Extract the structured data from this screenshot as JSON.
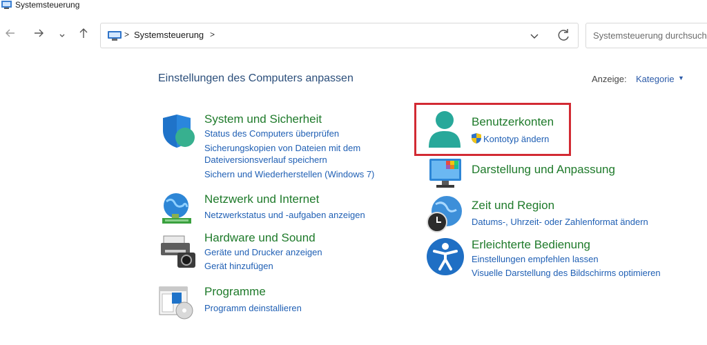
{
  "window": {
    "title": "Systemsteuerung"
  },
  "nav": {
    "back": "back-arrow-icon",
    "forward": "forward-arrow-icon",
    "recent": "chevron-down-icon",
    "up": "up-arrow-icon"
  },
  "address": {
    "crumb": "Systemsteuerung",
    "separator": ">"
  },
  "search": {
    "placeholder": "Systemsteuerung durchsuche"
  },
  "main": {
    "title": "Einstellungen des Computers anpassen",
    "view_label": "Anzeige:",
    "view_value": "Kategorie"
  },
  "categories": [
    {
      "title": "System und Sicherheit",
      "icon": "shield-icon",
      "links": [
        "Status des Computers überprüfen",
        "Sicherungskopien von Dateien mit dem",
        "Dateiversionsverlauf speichern",
        "Sichern und Wiederherstellen (Windows 7)"
      ]
    },
    {
      "title": "Netzwerk und Internet",
      "icon": "network-icon",
      "links": [
        "Netzwerkstatus und -aufgaben anzeigen"
      ]
    },
    {
      "title": "Hardware und Sound",
      "icon": "printer-icon",
      "links": [
        "Geräte und Drucker anzeigen",
        "Gerät hinzufügen"
      ]
    },
    {
      "title": "Programme",
      "icon": "programs-icon",
      "links": [
        "Programm deinstallieren"
      ]
    },
    {
      "title": "Benutzerkonten",
      "icon": "user-icon",
      "links": [
        "Kontotyp ändern"
      ]
    },
    {
      "title": "Darstellung und Anpassung",
      "icon": "monitor-icon",
      "links": []
    },
    {
      "title": "Zeit und Region",
      "icon": "globe-clock-icon",
      "links": [
        "Datums-, Uhrzeit- oder Zahlenformat ändern"
      ]
    },
    {
      "title": "Erleichterte Bedienung",
      "icon": "accessibility-icon",
      "links": [
        "Einstellungen empfehlen lassen",
        "Visuelle Darstellung des Bildschirms optimieren"
      ]
    }
  ],
  "colors": {
    "category_title": "#1e7a2a",
    "link": "#1f5fb4",
    "highlight": "#d22a33"
  }
}
